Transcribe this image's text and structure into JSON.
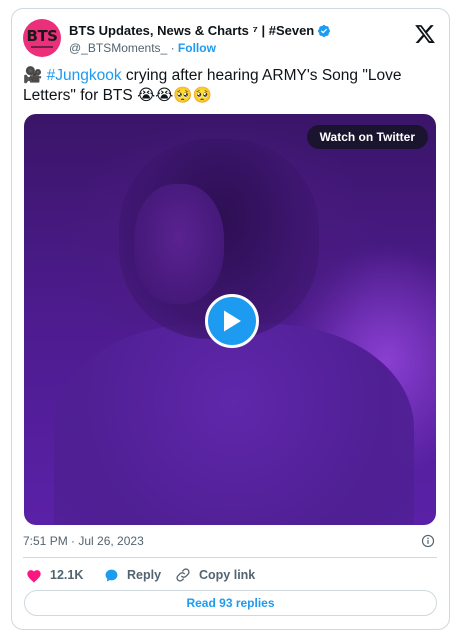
{
  "author": {
    "avatar_text": "BTS",
    "name": "BTS Updates, News & Charts ⁷ | #Seven",
    "handle": "@_BTSMoments_",
    "separator": "·",
    "follow_label": "Follow"
  },
  "tweet": {
    "prefix_emoji": "🎥",
    "hashtag": "#Jungkook",
    "text": " crying after hearing ARMY's Song \"Love Letters\" for BTS ",
    "trailing_emojis": "😭😭🥺🥺"
  },
  "media": {
    "watch_label": "Watch on Twitter",
    "play_icon": "play-icon"
  },
  "timestamp": "7:51 PM · Jul 26, 2023",
  "actions": {
    "like_count": "12.1K",
    "reply_label": "Reply",
    "copy_label": "Copy link"
  },
  "read_replies_label": "Read 93 replies",
  "colors": {
    "accent": "#1d9bf0",
    "like": "#f91880",
    "avatar_bg": "#ec2f7b",
    "border": "#cfd9de",
    "muted": "#536471"
  }
}
